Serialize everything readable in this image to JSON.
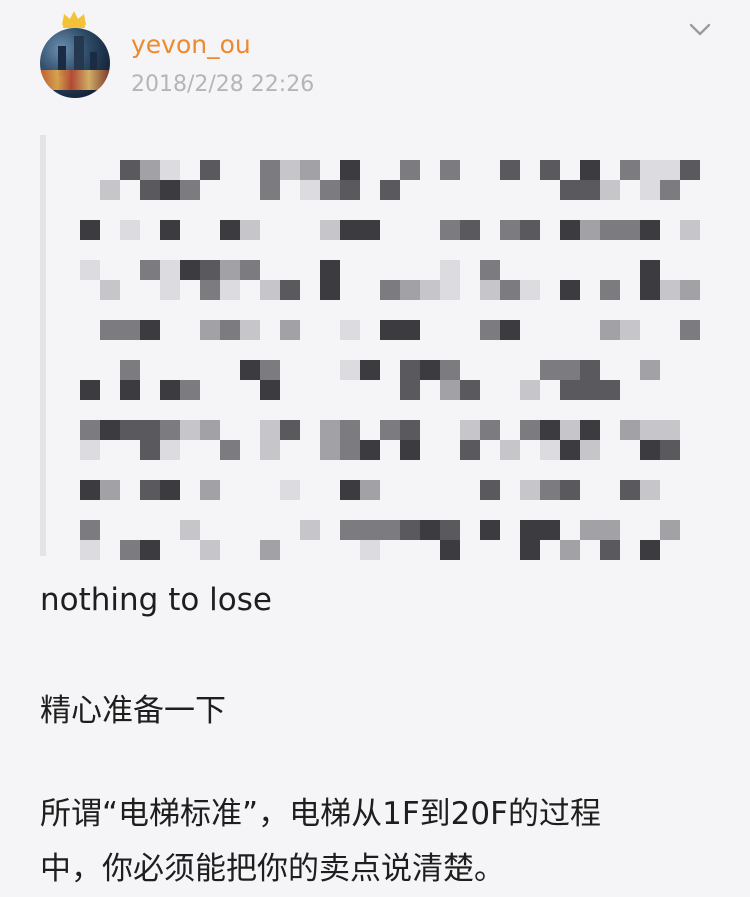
{
  "post": {
    "username": "yevon_ou",
    "timestamp": "2018/2/28 22:26",
    "lines": [
      "nothing to lose",
      "精心准备一下",
      "所谓“电梯标准”，电梯从1F到20F的过程",
      "中，你必须能把你的卖点说清楚。"
    ]
  },
  "icons": {
    "avatar": "avatar-image",
    "badge": "crown-icon",
    "menu": "chevron-down-icon"
  },
  "colors": {
    "username": "#ee8a2e",
    "crown": "#f3c238",
    "timestamp": "#b5b5b8",
    "background": "#f5f5f7"
  }
}
